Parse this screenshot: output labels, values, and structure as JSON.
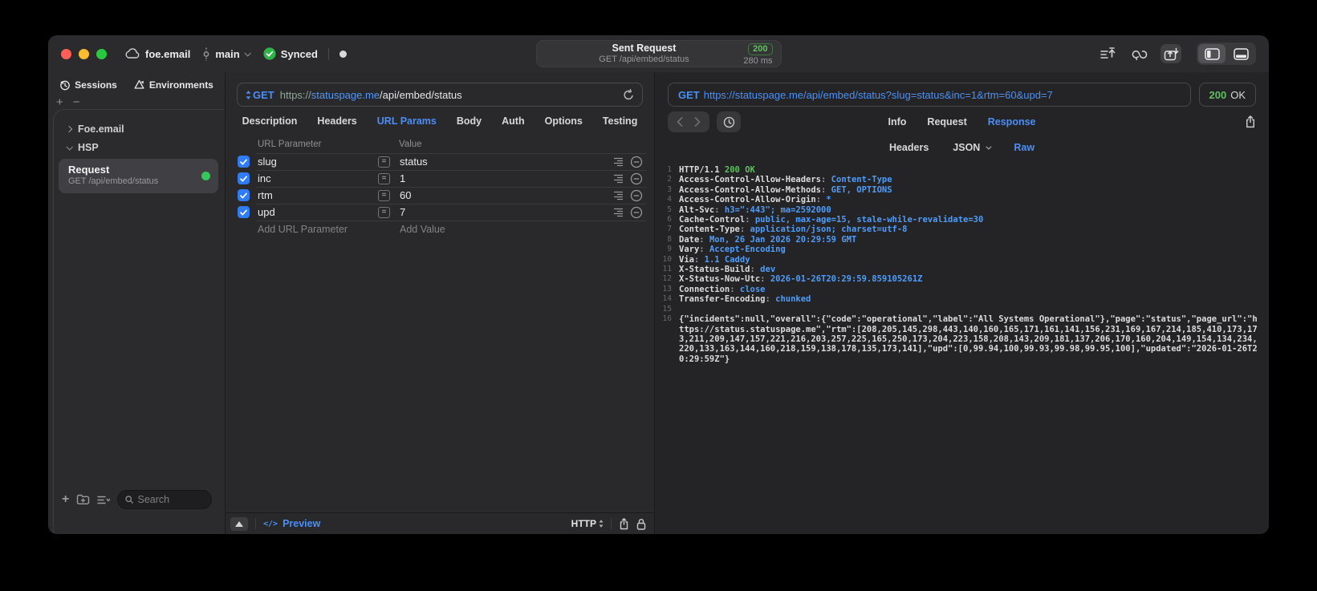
{
  "colors": {
    "accent_blue": "#4b8ef7",
    "status_green": "#5bc75d",
    "checkbox_blue": "#2f7cf6",
    "request_dot_green": "#34c759",
    "window_bg": "#2b2b2d"
  },
  "icons": {
    "cloud": "cloud outline",
    "branch": "git-commit dot on line",
    "synced_check": "check in green circle",
    "send_queue": "lines with up arrow",
    "sync_loop": "looped arrows",
    "import_export": "tray with up/down arrows",
    "panel_left": "window with left panel",
    "panel_bottom": "window with bottom panel",
    "sessions_clock": "history clock",
    "environments": "triangle cycle",
    "search": "magnifier",
    "refresh": "circular arrow",
    "equals": "=",
    "row_menu": "text lines",
    "row_delete": "minus in circle",
    "collapse": "up triangle",
    "share": "box with up arrow",
    "lock": "padlock",
    "clock": "clock"
  },
  "titlebar": {
    "project": "foe.email",
    "branch": "main",
    "sync_status": "Synced",
    "request": {
      "title": "Sent Request",
      "subtitle": "GET /api/embed/status",
      "status_code": "200",
      "duration": "280 ms"
    }
  },
  "sidebar": {
    "tabs": [
      {
        "label": "Sessions"
      },
      {
        "label": "Environments"
      }
    ],
    "tree": [
      {
        "label": "Foe.email"
      },
      {
        "label": "HSP"
      }
    ],
    "request_item": {
      "title": "Request",
      "subtitle": "GET /api/embed/status"
    },
    "search_placeholder": "Search"
  },
  "request_pane": {
    "method": "GET",
    "url": {
      "scheme": "https://",
      "host": "statuspage.me",
      "path": "/api/embed/status"
    },
    "tabs": [
      "Description",
      "Headers",
      "URL Params",
      "Body",
      "Auth",
      "Options",
      "Testing"
    ],
    "active_tab": "URL Params",
    "table": {
      "columns": [
        "URL Parameter",
        "Value"
      ],
      "rows": [
        {
          "name": "slug",
          "value": "status",
          "checked": true
        },
        {
          "name": "inc",
          "value": "1",
          "checked": true
        },
        {
          "name": "rtm",
          "value": "60",
          "checked": true
        },
        {
          "name": "upd",
          "value": "7",
          "checked": true
        }
      ],
      "add_row": {
        "name_placeholder": "Add URL Parameter",
        "value_placeholder": "Add Value"
      }
    },
    "footer": {
      "preview": "Preview",
      "code_glyph": "</>",
      "protocol": "HTTP"
    }
  },
  "response_pane": {
    "request_url": {
      "method": "GET",
      "url": "https://statuspage.me/api/embed/status?slug=status&inc=1&rtm=60&upd=7"
    },
    "status": {
      "code": "200",
      "text": "OK"
    },
    "tabs": [
      "Info",
      "Request",
      "Response"
    ],
    "active_tab": "Response",
    "subtabs": [
      {
        "label": "Headers"
      },
      {
        "label": "JSON",
        "dropdown": true
      },
      {
        "label": "Raw"
      }
    ],
    "active_subtab": "Raw",
    "raw": {
      "lines": [
        {
          "n": 1,
          "seg": [
            [
              "HTTP/1.1 ",
              "h"
            ],
            [
              "200 OK",
              "g"
            ]
          ]
        },
        {
          "n": 2,
          "seg": [
            [
              "Access-Control-Allow-Headers",
              "h"
            ],
            [
              ": ",
              "d"
            ],
            [
              "Content-Type",
              "b"
            ]
          ]
        },
        {
          "n": 3,
          "seg": [
            [
              "Access-Control-Allow-Methods",
              "h"
            ],
            [
              ": ",
              "d"
            ],
            [
              "GET, OPTIONS",
              "b"
            ]
          ]
        },
        {
          "n": 4,
          "seg": [
            [
              "Access-Control-Allow-Origin",
              "h"
            ],
            [
              ": ",
              "d"
            ],
            [
              "*",
              "b"
            ]
          ]
        },
        {
          "n": 5,
          "seg": [
            [
              "Alt-Svc",
              "h"
            ],
            [
              ": ",
              "d"
            ],
            [
              "h3=\":443\"; ma=2592000",
              "b"
            ]
          ]
        },
        {
          "n": 6,
          "seg": [
            [
              "Cache-Control",
              "h"
            ],
            [
              ": ",
              "d"
            ],
            [
              "public, max-age=15, stale-while-revalidate=30",
              "b"
            ]
          ]
        },
        {
          "n": 7,
          "seg": [
            [
              "Content-Type",
              "h"
            ],
            [
              ": ",
              "d"
            ],
            [
              "application/json; charset=utf-8",
              "b"
            ]
          ]
        },
        {
          "n": 8,
          "seg": [
            [
              "Date",
              "h"
            ],
            [
              ": ",
              "d"
            ],
            [
              "Mon, 26 Jan 2026 20:29:59 GMT",
              "b"
            ]
          ]
        },
        {
          "n": 9,
          "seg": [
            [
              "Vary",
              "h"
            ],
            [
              ": ",
              "d"
            ],
            [
              "Accept-Encoding",
              "b"
            ]
          ]
        },
        {
          "n": 10,
          "seg": [
            [
              "Via",
              "h"
            ],
            [
              ": ",
              "d"
            ],
            [
              "1.1 Caddy",
              "b"
            ]
          ]
        },
        {
          "n": 11,
          "seg": [
            [
              "X-Status-Build",
              "h"
            ],
            [
              ": ",
              "d"
            ],
            [
              "dev",
              "b"
            ]
          ]
        },
        {
          "n": 12,
          "seg": [
            [
              "X-Status-Now-Utc",
              "h"
            ],
            [
              ": ",
              "d"
            ],
            [
              "2026-01-26T20:29:59.859105261Z",
              "b"
            ]
          ]
        },
        {
          "n": 13,
          "seg": [
            [
              "Connection",
              "h"
            ],
            [
              ": ",
              "d"
            ],
            [
              "close",
              "b"
            ]
          ]
        },
        {
          "n": 14,
          "seg": [
            [
              "Transfer-Encoding",
              "h"
            ],
            [
              ": ",
              "d"
            ],
            [
              "chunked",
              "b"
            ]
          ]
        },
        {
          "n": 15,
          "seg": []
        },
        {
          "n": 16,
          "seg": [
            [
              "{\"incidents\":null,\"overall\":{\"code\":\"operational\",\"label\":\"All Systems Operational\"},\"page\":\"status\",\"page_url\":\"https://status.statuspage.me\",\"rtm\":[208,205,145,298,443,140,160,165,171,161,141,156,231,169,167,214,185,410,173,173,211,209,147,157,221,216,203,257,225,165,250,173,204,223,158,208,143,209,181,137,206,170,160,204,149,154,134,234,220,133,163,144,160,218,159,138,178,135,173,141],\"upd\":[0,99.94,100,99.93,99.98,99.95,100],\"updated\":\"2026-01-26T20:29:59Z\"}",
              "h"
            ]
          ]
        }
      ]
    }
  }
}
